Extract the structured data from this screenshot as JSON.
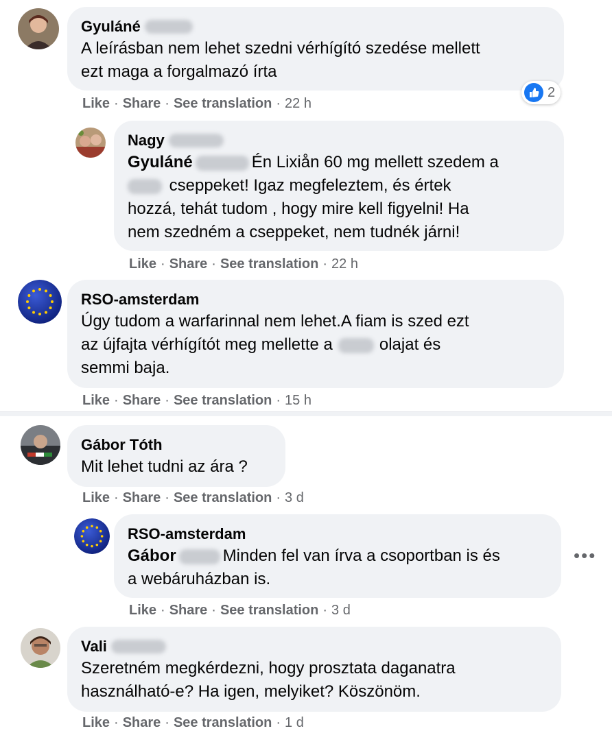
{
  "comments": [
    {
      "author": "Gyuláné",
      "lines": [
        "A leírásban nem lehet szedni vérhígító szedése mellett",
        "ezt maga a forgalmazó írta"
      ],
      "actions": {
        "like": "Like",
        "share": "Share",
        "translate": "See translation",
        "time": "22 h"
      },
      "reaction_count": "2"
    },
    {
      "author": "Nagy",
      "mention": "Gyuláné",
      "text_part1": "Én Lixiån 60 mg mellett szedem a",
      "text_part2": "cseppeket! Igaz megfeleztem, és értek",
      "text_part3": "hozzá, tehát tudom , hogy mire kell figyelni! Ha",
      "text_part4": "nem szedném a cseppeket, nem tudnék járni!",
      "actions": {
        "like": "Like",
        "share": "Share",
        "translate": "See translation",
        "time": "22 h"
      }
    },
    {
      "author": "RSO-amsterdam",
      "line1": "Úgy tudom a warfarinnal nem lehet.A fiam is szed ezt",
      "line2_a": "az újfajta vérhígítót meg mellette a",
      "line2_b": "olajat és",
      "line3": "semmi baja.",
      "actions": {
        "like": "Like",
        "share": "Share",
        "translate": "See translation",
        "time": "15 h"
      }
    },
    {
      "author": "Gábor Tóth",
      "text": "Mit lehet tudni az ára ?",
      "actions": {
        "like": "Like",
        "share": "Share",
        "translate": "See translation",
        "time": "3 d"
      }
    },
    {
      "author": "RSO-amsterdam",
      "mention": "Gábor",
      "text_part1": "Minden fel van írva a csoportban is és",
      "text_part2": "a webáruházban is.",
      "actions": {
        "like": "Like",
        "share": "Share",
        "translate": "See translation",
        "time": "3 d"
      }
    },
    {
      "author": "Vali",
      "lines": [
        "Szeretném megkérdezni, hogy prosztata daganatra",
        "használható-e? Ha igen, melyiket? Köszönöm."
      ],
      "actions": {
        "like": "Like",
        "share": "Share",
        "translate": "See translation",
        "time": "1 d"
      }
    }
  ],
  "more_options": "•••",
  "colors": {
    "bubble": "#f0f2f5",
    "meta": "#65676b",
    "like_blue": "#1877f2",
    "eu_blue": "#1a33a8",
    "eu_star": "#ffcc00"
  },
  "icons": [
    "like-icon",
    "more-options-icon",
    "eu-flag-avatar"
  ]
}
